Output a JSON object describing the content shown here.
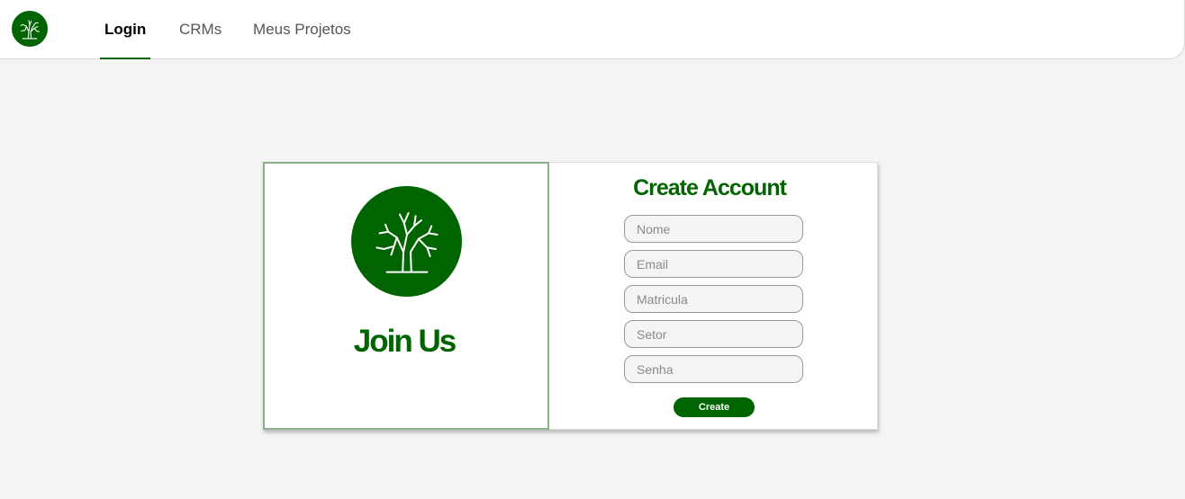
{
  "nav": {
    "logo_icon": "tree-icon",
    "tabs": [
      {
        "label": "Login",
        "active": true
      },
      {
        "label": "CRMs",
        "active": false
      },
      {
        "label": "Meus Projetos",
        "active": false
      }
    ]
  },
  "join_panel": {
    "logo_icon": "tree-icon",
    "title": "Join Us"
  },
  "form": {
    "title": "Create Account",
    "fields": [
      {
        "placeholder": "Nome",
        "value": ""
      },
      {
        "placeholder": "Email",
        "value": ""
      },
      {
        "placeholder": "Matricula",
        "value": ""
      },
      {
        "placeholder": "Setor",
        "value": ""
      },
      {
        "placeholder": "Senha",
        "value": ""
      }
    ],
    "submit_label": "Create"
  },
  "colors": {
    "brand": "#006400",
    "background": "#f4f4f4",
    "panel_border": "#8cb08c"
  }
}
